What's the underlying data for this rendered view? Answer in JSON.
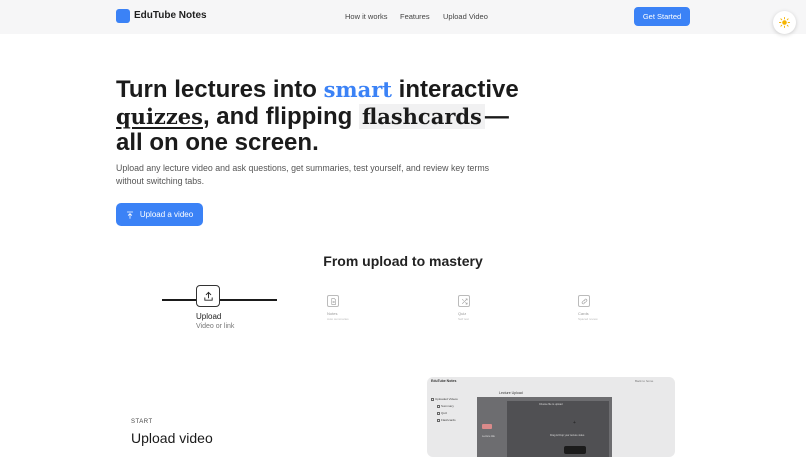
{
  "header": {
    "brand": "EduTube Notes",
    "nav": [
      "How it works",
      "Features",
      "Upload Video"
    ],
    "cta": "Get Started",
    "theme_icon": "sun-icon"
  },
  "hero": {
    "title_part1": "Turn lectures into ",
    "title_smart": "smart",
    "title_part2": " interactive ",
    "title_quizzes": "quizzes",
    "title_part3": ", and flipping ",
    "title_flashcards": "flashcards",
    "title_part4": "— all on one screen.",
    "subtitle": "Upload any lecture video and ask questions, get summaries, test yourself, and review key terms without switching tabs.",
    "upload_button": "Upload a video",
    "upload_icon": "upload-icon"
  },
  "steps": {
    "title": "From upload to mastery",
    "items": [
      {
        "label": "Upload",
        "sub": "Video or link",
        "icon": "upload-icon"
      },
      {
        "label": "Notes",
        "sub": "Auto summaries",
        "icon": "document-icon"
      },
      {
        "label": "Quiz",
        "sub": "Self test",
        "icon": "shuffle-icon"
      },
      {
        "label": "Cards",
        "sub": "Spaced review",
        "icon": "link-icon"
      }
    ]
  },
  "section": {
    "kicker": "START",
    "title": "Upload video"
  },
  "preview": {
    "title": "EduTube Notes",
    "top_right": "Back to home",
    "sidebar": [
      "Uploaded Videos",
      "Summary",
      "Quiz",
      "Flashcards"
    ],
    "heading": "Lecture Upload",
    "modal_title": "Choose file to upload",
    "drop_text": "Drag & Drop your lecture video",
    "lecture_label": "Lecture title"
  }
}
